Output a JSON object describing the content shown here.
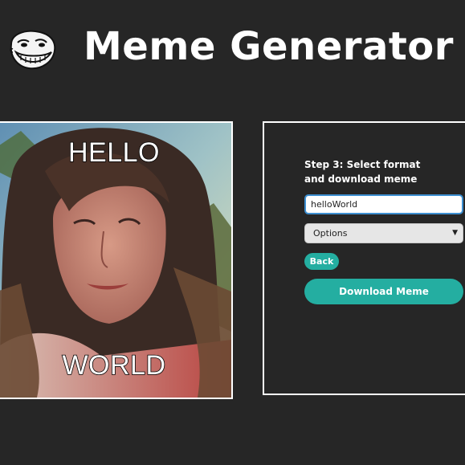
{
  "header": {
    "logo_icon": "troll-face-icon",
    "title": "Meme Generator"
  },
  "meme": {
    "top_text": "HELLO",
    "bottom_text": "WORLD"
  },
  "panel": {
    "step_title": "Step 3: Select format and download meme",
    "filename_value": "helloWorld",
    "format_select": "Options",
    "back_label": "Back",
    "download_label": "Download Meme"
  },
  "colors": {
    "background": "#262626",
    "accent": "#24aea1",
    "border": "#ffffff"
  }
}
